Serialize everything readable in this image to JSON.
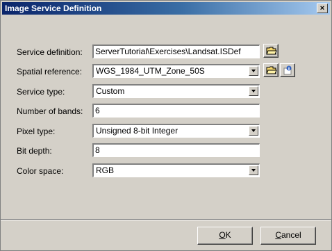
{
  "window": {
    "title": "Image Service Definition",
    "close_label": "×"
  },
  "fields": {
    "service_definition": {
      "label": "Service definition:",
      "value": "ServerTutorial\\Exercises\\Landsat.ISDef"
    },
    "spatial_reference": {
      "label": "Spatial reference:",
      "value": "WGS_1984_UTM_Zone_50S"
    },
    "service_type": {
      "label": "Service type:",
      "value": "Custom"
    },
    "number_of_bands": {
      "label": "Number of bands:",
      "value": "6"
    },
    "pixel_type": {
      "label": "Pixel type:",
      "value": "Unsigned 8-bit Integer"
    },
    "bit_depth": {
      "label": "Bit depth:",
      "value": "8"
    },
    "color_space": {
      "label": "Color space:",
      "value": "RGB"
    }
  },
  "buttons": {
    "ok": {
      "mnemonic": "O",
      "rest": "K"
    },
    "cancel": {
      "mnemonic": "C",
      "rest": "ancel"
    }
  },
  "icons": {
    "folder": "folder-open-icon",
    "properties": "properties-info-icon"
  }
}
